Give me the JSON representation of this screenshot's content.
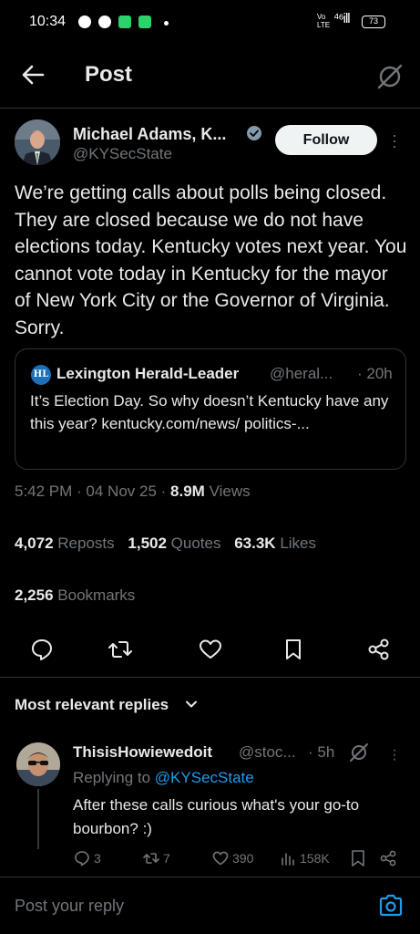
{
  "status_bar": {
    "time": "10:34",
    "network": "Vo\nLTE",
    "signal": "⁴⁶ill",
    "battery": "73"
  },
  "header": {
    "title": "Post",
    "back_icon": "arrow-left-icon",
    "grok_icon": "grok-icon"
  },
  "post": {
    "author_name": "Michael Adams, K...",
    "author_handle": "@KYSecState",
    "follow_label": "Follow",
    "text": "We’re getting calls about polls being closed. They are closed because we do not have elections today. Kentucky votes next year. You cannot vote today in Kentucky for the mayor of New York City or the Governor of Virginia. Sorry.",
    "quote": {
      "logo_text": "HL",
      "name": "Lexington Herald-Leader",
      "handle": "@heral...",
      "time": "· 20h",
      "text": "It’s Election Day. So why doesn’t Kentucky have any this year? kentucky.com/news/ politics-..."
    },
    "time": "5:42 PM",
    "date": "04 Nov 25",
    "views_count": "8.9M",
    "views_label": "Views",
    "reposts_count": "4,072",
    "reposts_label": "Reposts",
    "quotes_count": "1,502",
    "quotes_label": "Quotes",
    "likes_count": "63.3K",
    "likes_label": "Likes",
    "bookmarks_count": "2,256",
    "bookmarks_label": "Bookmarks"
  },
  "replies_section": {
    "label": "Most relevant replies"
  },
  "reply": {
    "name": "ThisisHowiewedoit",
    "handle": "@stoc...",
    "time": "· 5h",
    "replying_prefix": "Replying to",
    "replying_handle": "@KYSecState",
    "text": "After these calls curious what's your go-to bourbon? :)",
    "replies": "3",
    "reposts": "7",
    "likes": "390",
    "views": "158K"
  },
  "composer": {
    "placeholder": "Post your reply"
  },
  "colors": {
    "background": "#000000",
    "accent": "#1d9bf0",
    "muted": "#71767b",
    "text": "#e7e9ea",
    "divider": "#2f3336"
  }
}
